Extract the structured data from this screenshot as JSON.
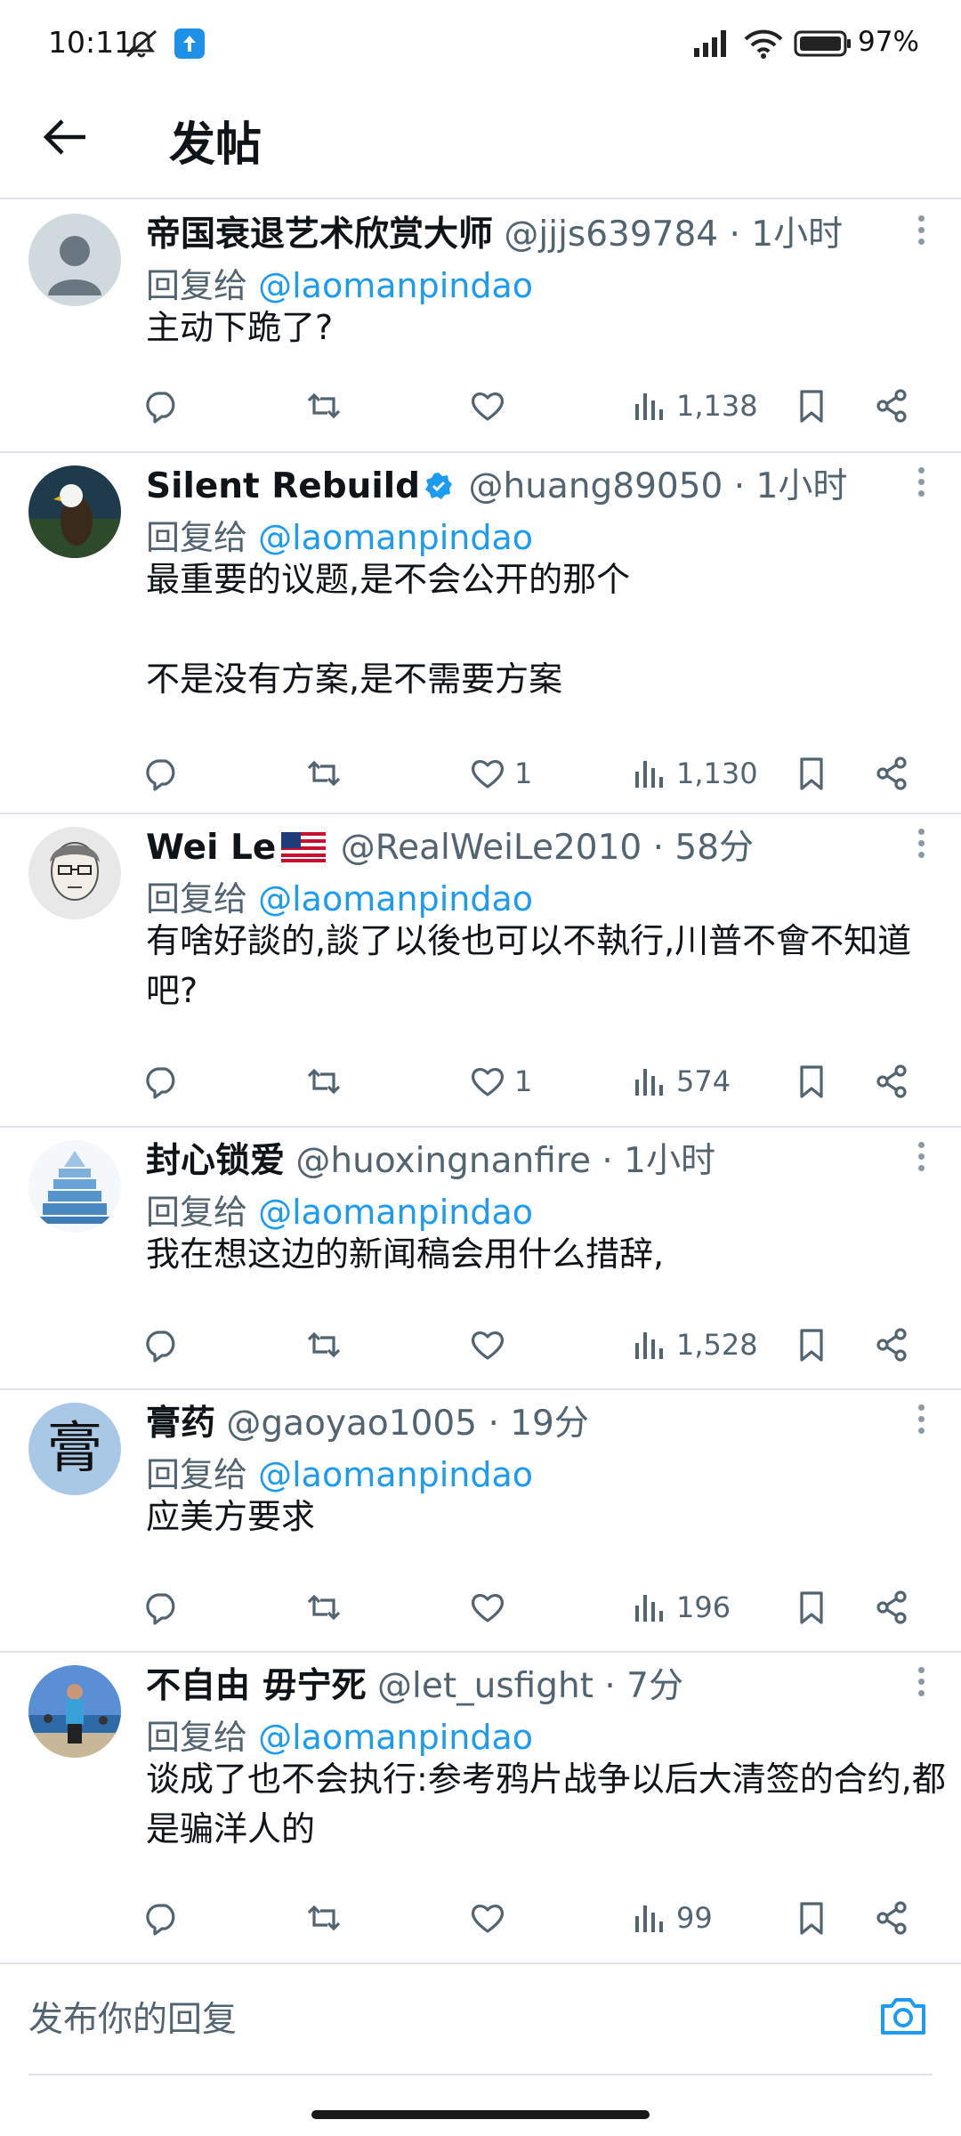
{
  "status_bar": {
    "time": "10:11",
    "battery": "97%"
  },
  "header": {
    "title": "发帖"
  },
  "tweets": [
    {
      "name": "帝国衰退艺术欣赏大师",
      "handle": "@jjjs639784",
      "time": "· 1小时",
      "reply_prefix": "回复给",
      "reply_to": "@laomanpindao",
      "text": "主动下跪了?",
      "likes": "",
      "views": "1,138",
      "avatar": "default-avatar"
    },
    {
      "name": "Silent Rebuild",
      "handle": "@huang89050",
      "time": "· 1小时",
      "reply_prefix": "回复给",
      "reply_to": "@laomanpindao",
      "text": "最重要的议题,是不会公开的那个\n\n不是没有方案,是不需要方案",
      "likes": "1",
      "views": "1,130",
      "avatar": "eagle-avatar",
      "verified": true
    },
    {
      "name": "Wei Le",
      "handle": "@RealWeiLe2010",
      "time": "· 58分",
      "reply_prefix": "回复给",
      "reply_to": "@laomanpindao",
      "text": "有啥好談的,談了以後也可以不執行,川普不會不知道吧?",
      "likes": "1",
      "views": "574",
      "avatar": "portrait-avatar",
      "flag": "us-flag"
    },
    {
      "name": "封心锁爱",
      "handle": "@huoxingnanfire",
      "time": "· 1小时",
      "reply_prefix": "回复给",
      "reply_to": "@laomanpindao",
      "text": "我在想这边的新闻稿会用什么措辞,",
      "likes": "",
      "views": "1,528",
      "avatar": "pyramid-avatar"
    },
    {
      "name": "膏药",
      "handle": "@gaoyao1005",
      "time": "· 19分",
      "reply_prefix": "回复给",
      "reply_to": "@laomanpindao",
      "text": "应美方要求",
      "likes": "",
      "views": "196",
      "avatar": "character-avatar",
      "avatar_char": "膏"
    },
    {
      "name": "不自由 毋宁死",
      "handle": "@let_usfight",
      "time": "· 7分",
      "reply_prefix": "回复给",
      "reply_to": "@laomanpindao",
      "text": "谈成了也不会执行:参考鸦片战争以后大清签的合约,都是骗洋人的",
      "likes": "",
      "views": "99",
      "avatar": "beach-avatar"
    }
  ],
  "composer": {
    "placeholder": "发布你的回复"
  },
  "colors": {
    "accent": "#1d9bf0",
    "muted": "#536471",
    "divider": "#e1e4e8"
  }
}
